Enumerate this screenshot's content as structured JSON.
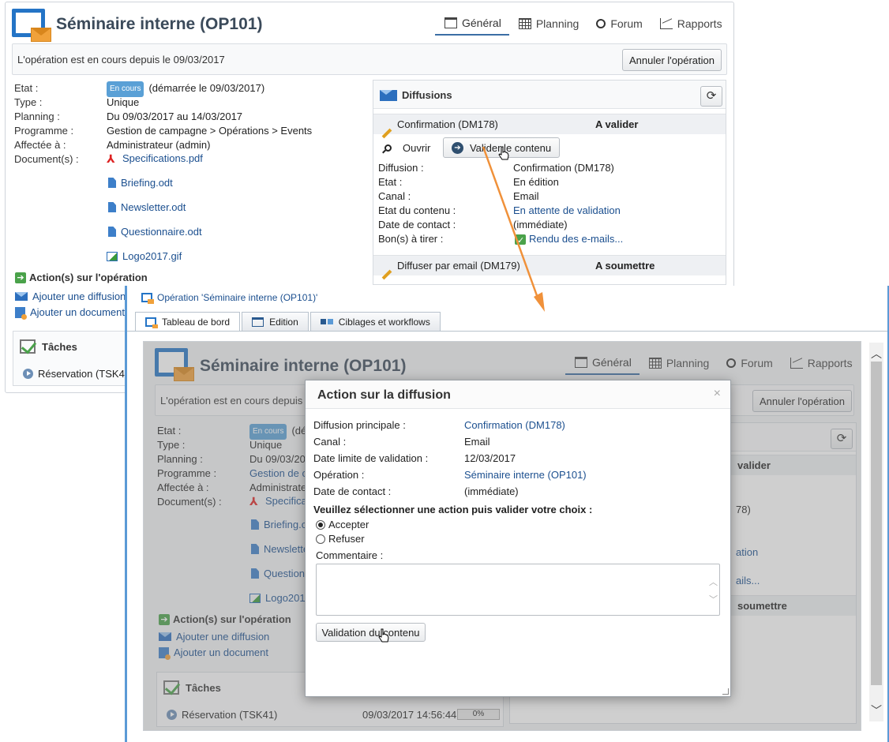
{
  "operation": {
    "title": "Séminaire interne (OP101)",
    "status_text": "L'opération est en cours depuis le 09/03/2017",
    "status_text_short": "L'opération est en cours depuis l",
    "cancel_label": "Annuler l'opération",
    "tabs": [
      {
        "label": "Général",
        "icon": "general-icon",
        "active": true
      },
      {
        "label": "Planning",
        "icon": "calendar-icon"
      },
      {
        "label": "Forum",
        "icon": "forum-icon"
      },
      {
        "label": "Rapports",
        "icon": "chart-icon"
      }
    ],
    "fields": {
      "etat_label": "Etat :",
      "etat_badge": "En cours",
      "etat_value": "(démarrée le 09/03/2017)",
      "etat_value_short": "(dé",
      "type_label": "Type :",
      "type_value": "Unique",
      "planning_label": "Planning :",
      "planning_value": "Du 09/03/2017 au 14/03/2017",
      "planning_value_short": "Du 09/03/20",
      "programme_label": "Programme :",
      "programme_value": "Gestion de campagne > Opérations > Events",
      "programme_value_short": "Gestion de c",
      "affectee_label": "Affectée à :",
      "affectee_value": "Administrateur (admin)",
      "affectee_value_short": "Administrate",
      "documents_label": "Document(s) :"
    },
    "documents": [
      "Specifications.pdf",
      "Briefing.odt",
      "Newsletter.odt",
      "Questionnaire.odt",
      "Logo2017.gif"
    ],
    "documents_short": [
      "Specifica",
      "Briefing.o",
      "Newslette",
      "Question",
      "Logo2017"
    ],
    "actions_title": "Action(s) sur l'opération",
    "add_delivery": "Ajouter une diffusion",
    "add_document": "Ajouter un document",
    "tasks_title": "Tâches",
    "task_name": "Réservation (TSK41)",
    "task_name_short": "Réservation (TSK4",
    "task_date": "09/03/2017 14:56:44",
    "task_progress": "0%"
  },
  "diffusions": {
    "title": "Diffusions",
    "item1": {
      "name": "Confirmation (DM178)",
      "status": "A valider",
      "status_short": "valider"
    },
    "open_label": "Ouvrir",
    "validate_label": "Valider le contenu",
    "details": [
      {
        "k": "Diffusion :",
        "v": "Confirmation (DM178)",
        "link": false,
        "v_short": "78)"
      },
      {
        "k": "Etat :",
        "v": "En édition",
        "link": false
      },
      {
        "k": "Canal :",
        "v": "Email",
        "link": false
      },
      {
        "k": "Etat du contenu :",
        "v": "En attente de validation",
        "link": true,
        "v_short": "ation"
      },
      {
        "k": "Date de contact :",
        "v": "(immédiate)",
        "link": false
      },
      {
        "k": "Bon(s) à tirer :",
        "v": "Rendu des e-mails...",
        "link": true,
        "v_short": "ails..."
      }
    ],
    "item2": {
      "name": "Diffuser par email (DM179)",
      "status": "A soumettre",
      "status_short": "soumettre"
    }
  },
  "front": {
    "breadcrumb": "Opération 'Séminaire interne (OP101)'",
    "tabs": [
      "Tableau de bord",
      "Edition",
      "Ciblages et workflows"
    ]
  },
  "modal": {
    "title": "Action sur la diffusion",
    "close": "×",
    "rows": [
      {
        "k": "Diffusion principale :",
        "v": "Confirmation (DM178)",
        "link": true
      },
      {
        "k": "Canal :",
        "v": "Email",
        "link": false
      },
      {
        "k": "Date limite de validation :",
        "v": "12/03/2017",
        "link": false
      },
      {
        "k": "Opération :",
        "v": "Séminaire interne (OP101)",
        "link": true
      },
      {
        "k": "Date de contact :",
        "v": "(immédiate)",
        "link": false
      }
    ],
    "question": "Veuillez sélectionner une action puis valider votre choix :",
    "option_accept": "Accepter",
    "option_refuse": "Refuser",
    "selected": "Accepter",
    "comment_label": "Commentaire :",
    "comment_value": "",
    "submit_label": "Validation du contenu"
  },
  "colors": {
    "accent": "#2474c6",
    "link": "#1b4f8f",
    "badge": "#5aa0d6",
    "arrow": "#f0913a"
  }
}
